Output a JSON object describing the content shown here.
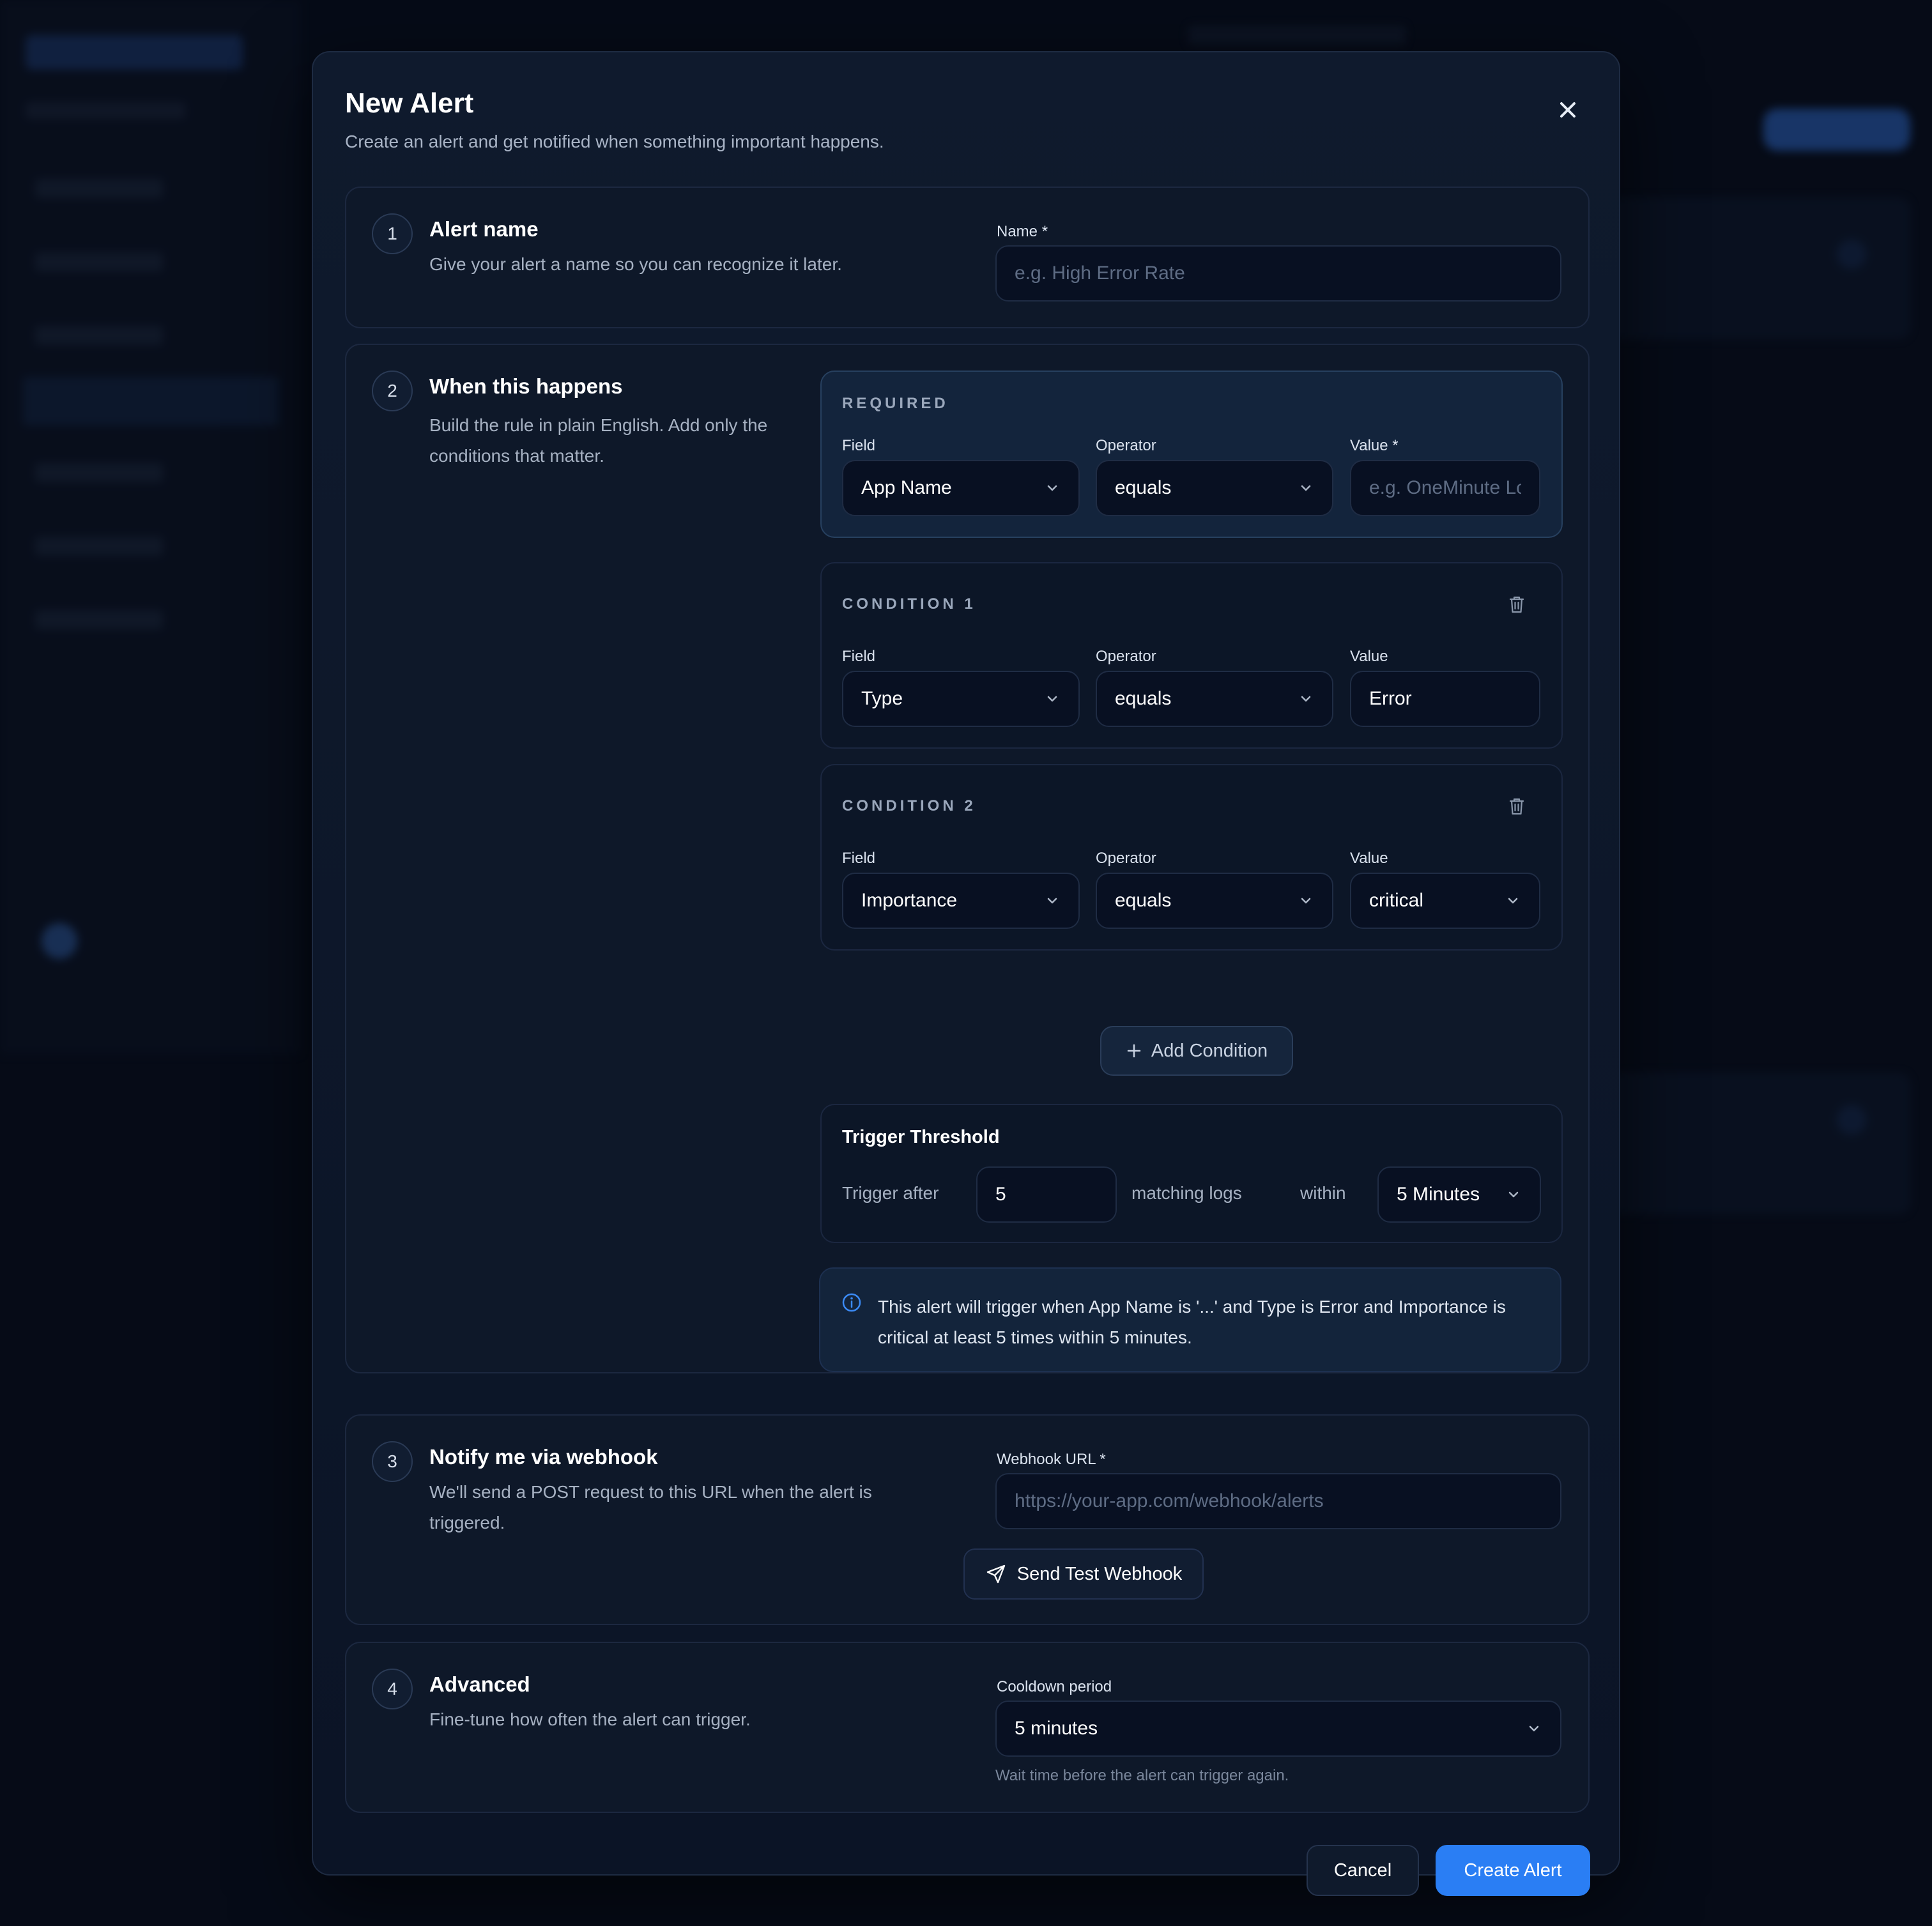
{
  "modal": {
    "title": "New Alert",
    "subtitle": "Create an alert and get notified when something important happens."
  },
  "steps": [
    {
      "number": "1",
      "title": "Alert name",
      "description": "Give your alert a name so you can recognize it later.",
      "name_label": "Name *",
      "name_placeholder": "e.g. High Error Rate",
      "name_value": ""
    },
    {
      "number": "2",
      "title": "When this happens",
      "description": "Build the rule in plain English. Add only the conditions that matter."
    },
    {
      "number": "3",
      "title": "Notify me via webhook",
      "description": "We'll send a POST request to this URL when the alert is triggered.",
      "url_label": "Webhook URL *",
      "url_placeholder": "https://your-app.com/webhook/alerts",
      "url_value": "",
      "test_button": "Send Test Webhook"
    },
    {
      "number": "4",
      "title": "Advanced",
      "description": "Fine-tune how often the alert can trigger.",
      "cooldown_label": "Cooldown period",
      "cooldown_value": "5 minutes",
      "cooldown_help": "Wait time before the alert can trigger again."
    }
  ],
  "required": {
    "title": "REQUIRED",
    "field_label": "Field",
    "field_value": "App Name",
    "operator_label": "Operator",
    "operator_value": "equals",
    "value_label": "Value *",
    "value_placeholder": "e.g. OneMinute Lo",
    "value_value": ""
  },
  "conditions": [
    {
      "title": "CONDITION 1",
      "field_label": "Field",
      "field_value": "Type",
      "operator_label": "Operator",
      "operator_value": "equals",
      "value_label": "Value",
      "value_value": "Error"
    },
    {
      "title": "CONDITION 2",
      "field_label": "Field",
      "field_value": "Importance",
      "operator_label": "Operator",
      "operator_value": "equals",
      "value_label": "Value",
      "value_value": "critical"
    }
  ],
  "add_condition_label": "Add Condition",
  "threshold": {
    "title": "Trigger Threshold",
    "prefix": "Trigger after",
    "count": "5",
    "middle": "matching logs",
    "within": "within",
    "window": "5 Minutes"
  },
  "summary": "This alert will trigger when App Name is '...' and Type is Error and Importance is critical at least 5 times within 5 minutes.",
  "footer": {
    "cancel": "Cancel",
    "create": "Create Alert"
  },
  "colors": {
    "accent": "#2a7ef4",
    "background": "#060b17",
    "modal": "#0f1a2d"
  }
}
